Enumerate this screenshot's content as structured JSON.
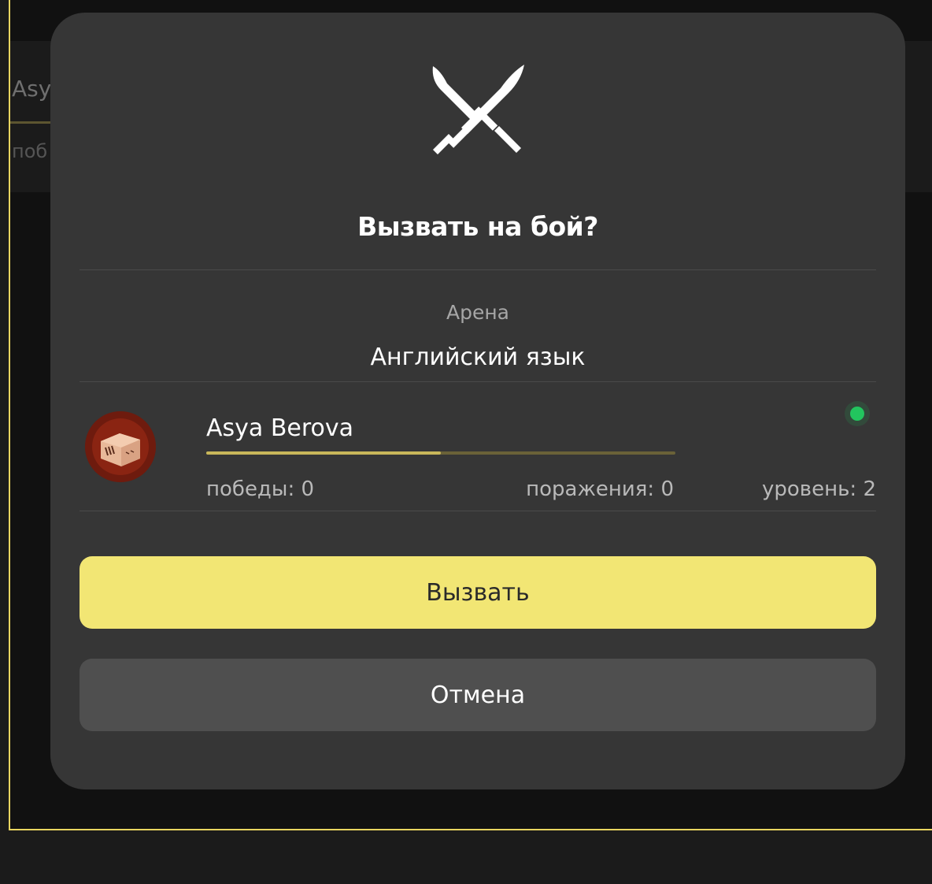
{
  "background": {
    "player_name_partial": "Asy",
    "stats_partial": "поб"
  },
  "modal": {
    "icon": "crossed-swords-icon",
    "title": "Вызвать на бой?",
    "arena_label": "Арена",
    "arena_value": "Английский язык",
    "opponent": {
      "avatar_icon": "box-avatar",
      "name": "Asya Berova",
      "online_status": "online",
      "progress_fraction": 0.5,
      "wins_label": "победы: 0",
      "losses_label": "поражения: 0",
      "level_label": "уровень: 2"
    },
    "confirm_label": "Вызвать",
    "cancel_label": "Отмена"
  },
  "colors": {
    "accent": "#f2e674",
    "frame_border": "#e9d560",
    "modal_bg": "#363636",
    "online": "#22c55e",
    "progress": "#c9b75a"
  }
}
